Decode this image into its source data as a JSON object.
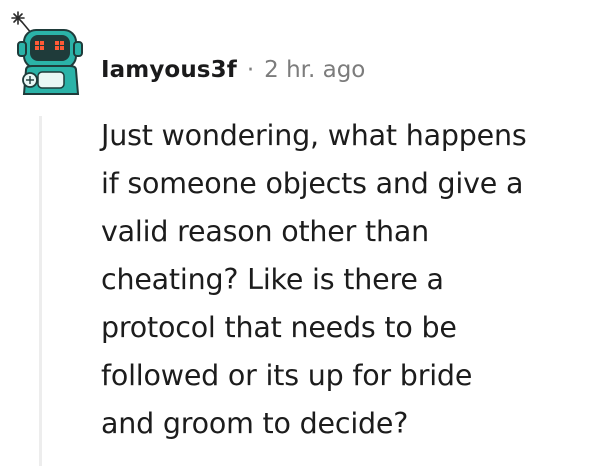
{
  "comment": {
    "author": "Iamyous3f",
    "separator": "·",
    "timestamp": "2 hr. ago",
    "avatar_icon": "robot-avatar-icon",
    "lines": [
      "Just wondering, what happens",
      "if someone objects and give a",
      "valid reason other than",
      "cheating? Like is there a",
      "protocol that needs to be",
      "followed or its up for bride",
      "and groom to decide?"
    ]
  },
  "colors": {
    "avatar_primary": "#2bb3a8",
    "avatar_dark": "#1f3b3a",
    "thread_line": "#ededed",
    "text": "#1c1c1c",
    "meta": "#7c7c7c"
  }
}
